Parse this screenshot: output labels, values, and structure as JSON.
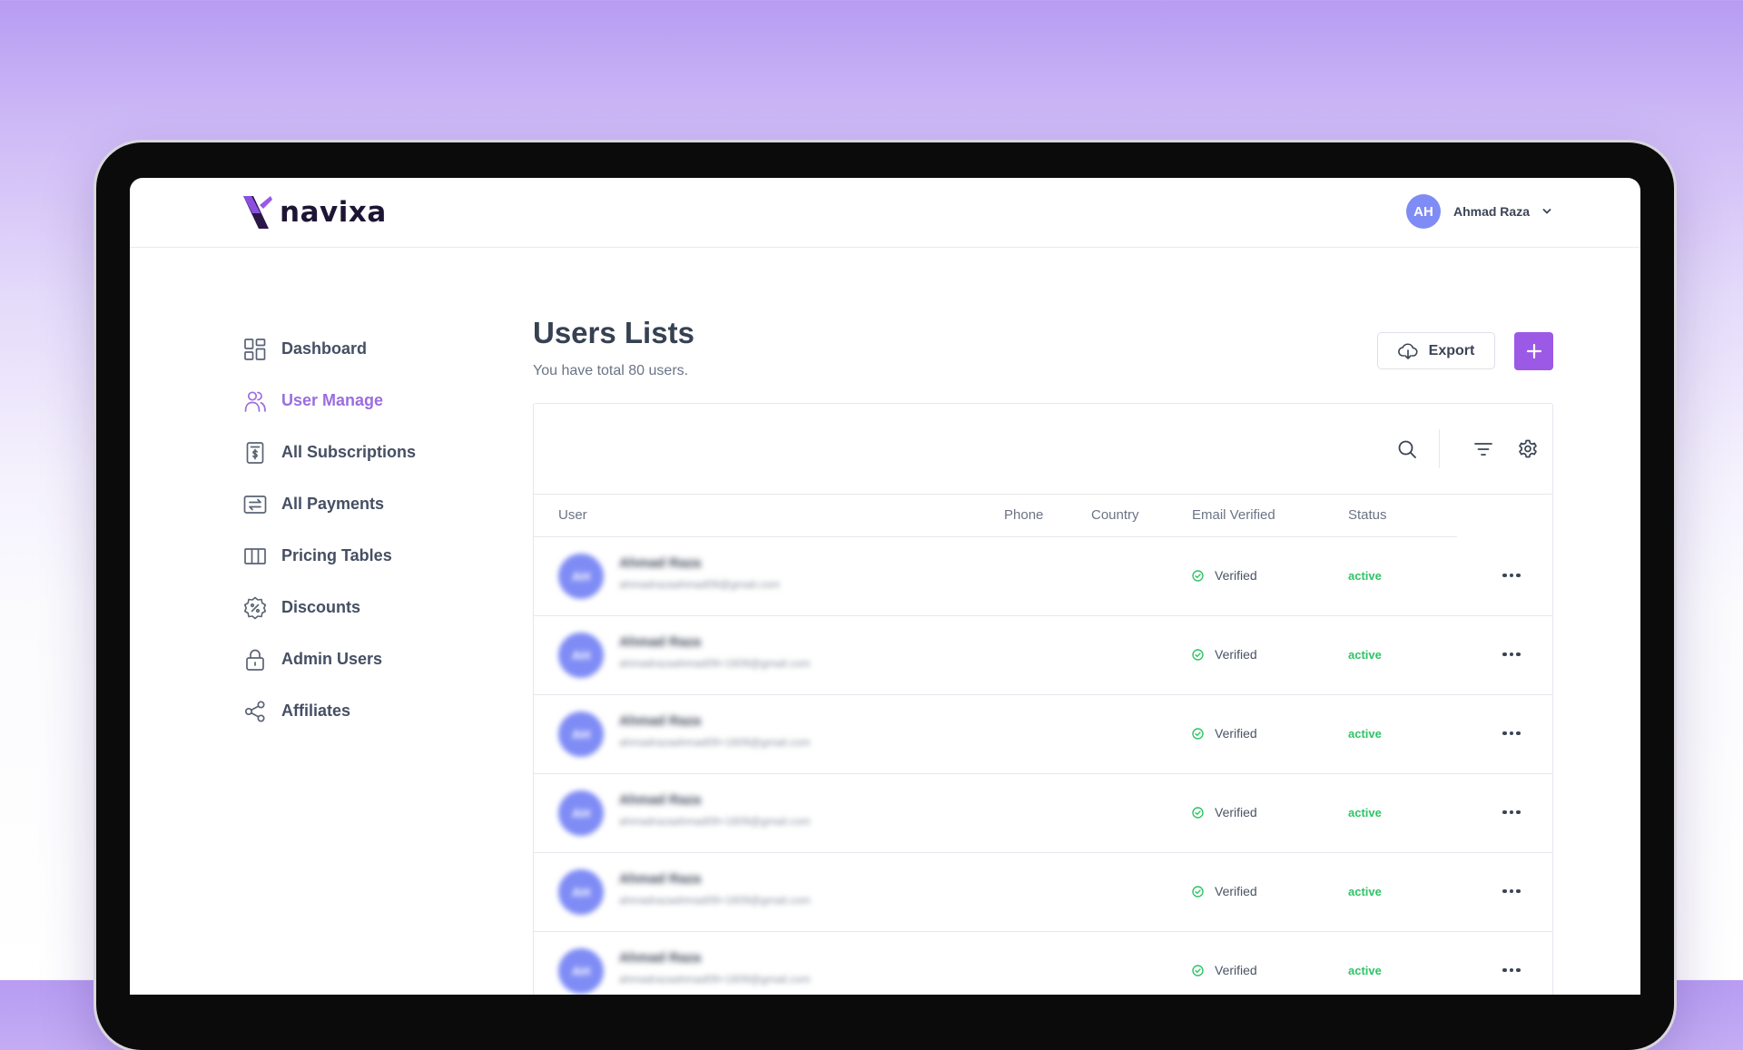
{
  "app": {
    "brand": "navixa",
    "accent_color": "#9b59e6",
    "status_color": "#2fc466"
  },
  "header": {
    "user_initials": "AH",
    "user_name": "Ahmad Raza"
  },
  "sidebar": {
    "items": [
      {
        "label": "Dashboard",
        "icon": "dashboard-grid-icon"
      },
      {
        "label": "User Manage",
        "icon": "users-icon",
        "active": true
      },
      {
        "label": "All Subscriptions",
        "icon": "subscription-doc-icon"
      },
      {
        "label": "All Payments",
        "icon": "payments-icon"
      },
      {
        "label": "Pricing Tables",
        "icon": "columns-icon"
      },
      {
        "label": "Discounts",
        "icon": "discount-badge-icon"
      },
      {
        "label": "Admin Users",
        "icon": "lock-icon"
      },
      {
        "label": "Affiliates",
        "icon": "share-nodes-icon"
      }
    ]
  },
  "main": {
    "title": "Users Lists",
    "subtitle": "You have total 80 users.",
    "export_label": "Export",
    "table": {
      "columns": [
        "User",
        "Phone",
        "Country",
        "Email Verified",
        "Status"
      ],
      "rows": [
        {
          "initials": "AH",
          "name": "Ahmad Raza",
          "email": "ahmadrazaahmad09@gmail.com",
          "verified": "Verified",
          "status": "active"
        },
        {
          "initials": "AH",
          "name": "Ahmad Raza",
          "email": "ahmadrazaahmad09+1609@gmail.com",
          "verified": "Verified",
          "status": "active"
        },
        {
          "initials": "AH",
          "name": "Ahmad Raza",
          "email": "ahmadrazaahmad09+1609@gmail.com",
          "verified": "Verified",
          "status": "active"
        },
        {
          "initials": "AH",
          "name": "Ahmad Raza",
          "email": "ahmadrazaahmad09+1609@gmail.com",
          "verified": "Verified",
          "status": "active"
        },
        {
          "initials": "AH",
          "name": "Ahmad Raza",
          "email": "ahmadrazaahmad09+1609@gmail.com",
          "verified": "Verified",
          "status": "active"
        },
        {
          "initials": "AH",
          "name": "Ahmad Raza",
          "email": "ahmadrazaahmad09+1609@gmail.com",
          "verified": "Verified",
          "status": "active"
        }
      ]
    }
  }
}
